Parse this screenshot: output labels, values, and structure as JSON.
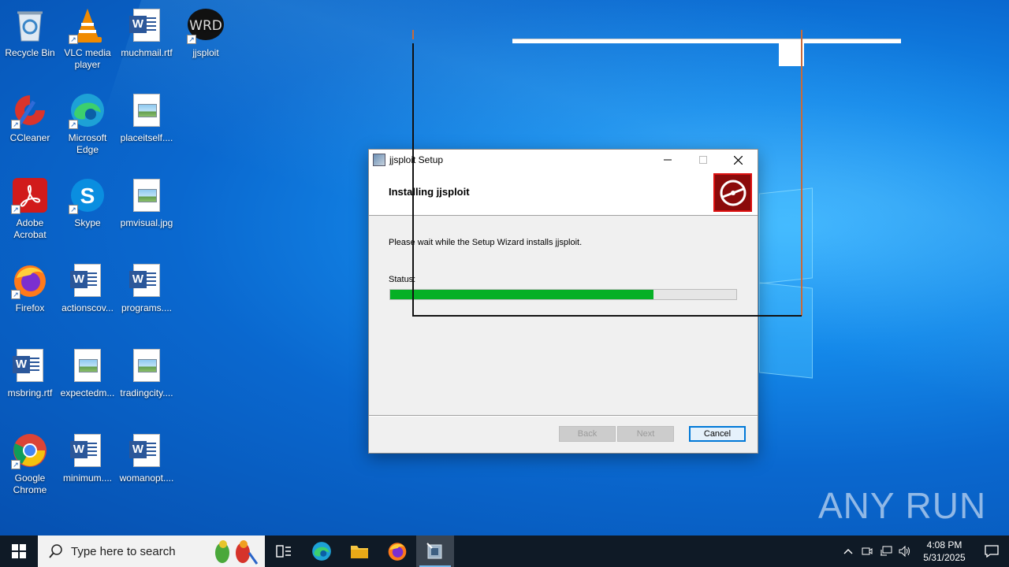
{
  "desktop": {
    "icons": [
      {
        "label": "Recycle Bin"
      },
      {
        "label": "VLC media player"
      },
      {
        "label": "muchmail.rtf"
      },
      {
        "label": "jjsploit"
      },
      {
        "label": "CCleaner"
      },
      {
        "label": "Microsoft Edge"
      },
      {
        "label": "placeitself...."
      },
      {
        "label": "Adobe Acrobat"
      },
      {
        "label": "Skype"
      },
      {
        "label": "pmvisual.jpg"
      },
      {
        "label": "Firefox"
      },
      {
        "label": "actionscov..."
      },
      {
        "label": "programs...."
      },
      {
        "label": "msbring.rtf"
      },
      {
        "label": "expectedm..."
      },
      {
        "label": "tradingcity...."
      },
      {
        "label": "Google Chrome"
      },
      {
        "label": "minimum...."
      },
      {
        "label": "womanopt...."
      }
    ],
    "watermark": "ANY RUN"
  },
  "dialog": {
    "title": "jjsploit Setup",
    "heading": "Installing jjsploit",
    "message": "Please wait while the Setup Wizard installs jjsploit.",
    "status_label": "Status:",
    "progress": 0.76,
    "buttons": {
      "back": "Back",
      "next": "Next",
      "cancel": "Cancel"
    }
  },
  "taskbar": {
    "search_placeholder": "Type here to search",
    "time": "4:08 PM",
    "date": "5/31/2025"
  },
  "colors": {
    "progress_fill": "#06b025",
    "taskbar_bg": "#0f1a26",
    "accent": "#0078d7"
  }
}
